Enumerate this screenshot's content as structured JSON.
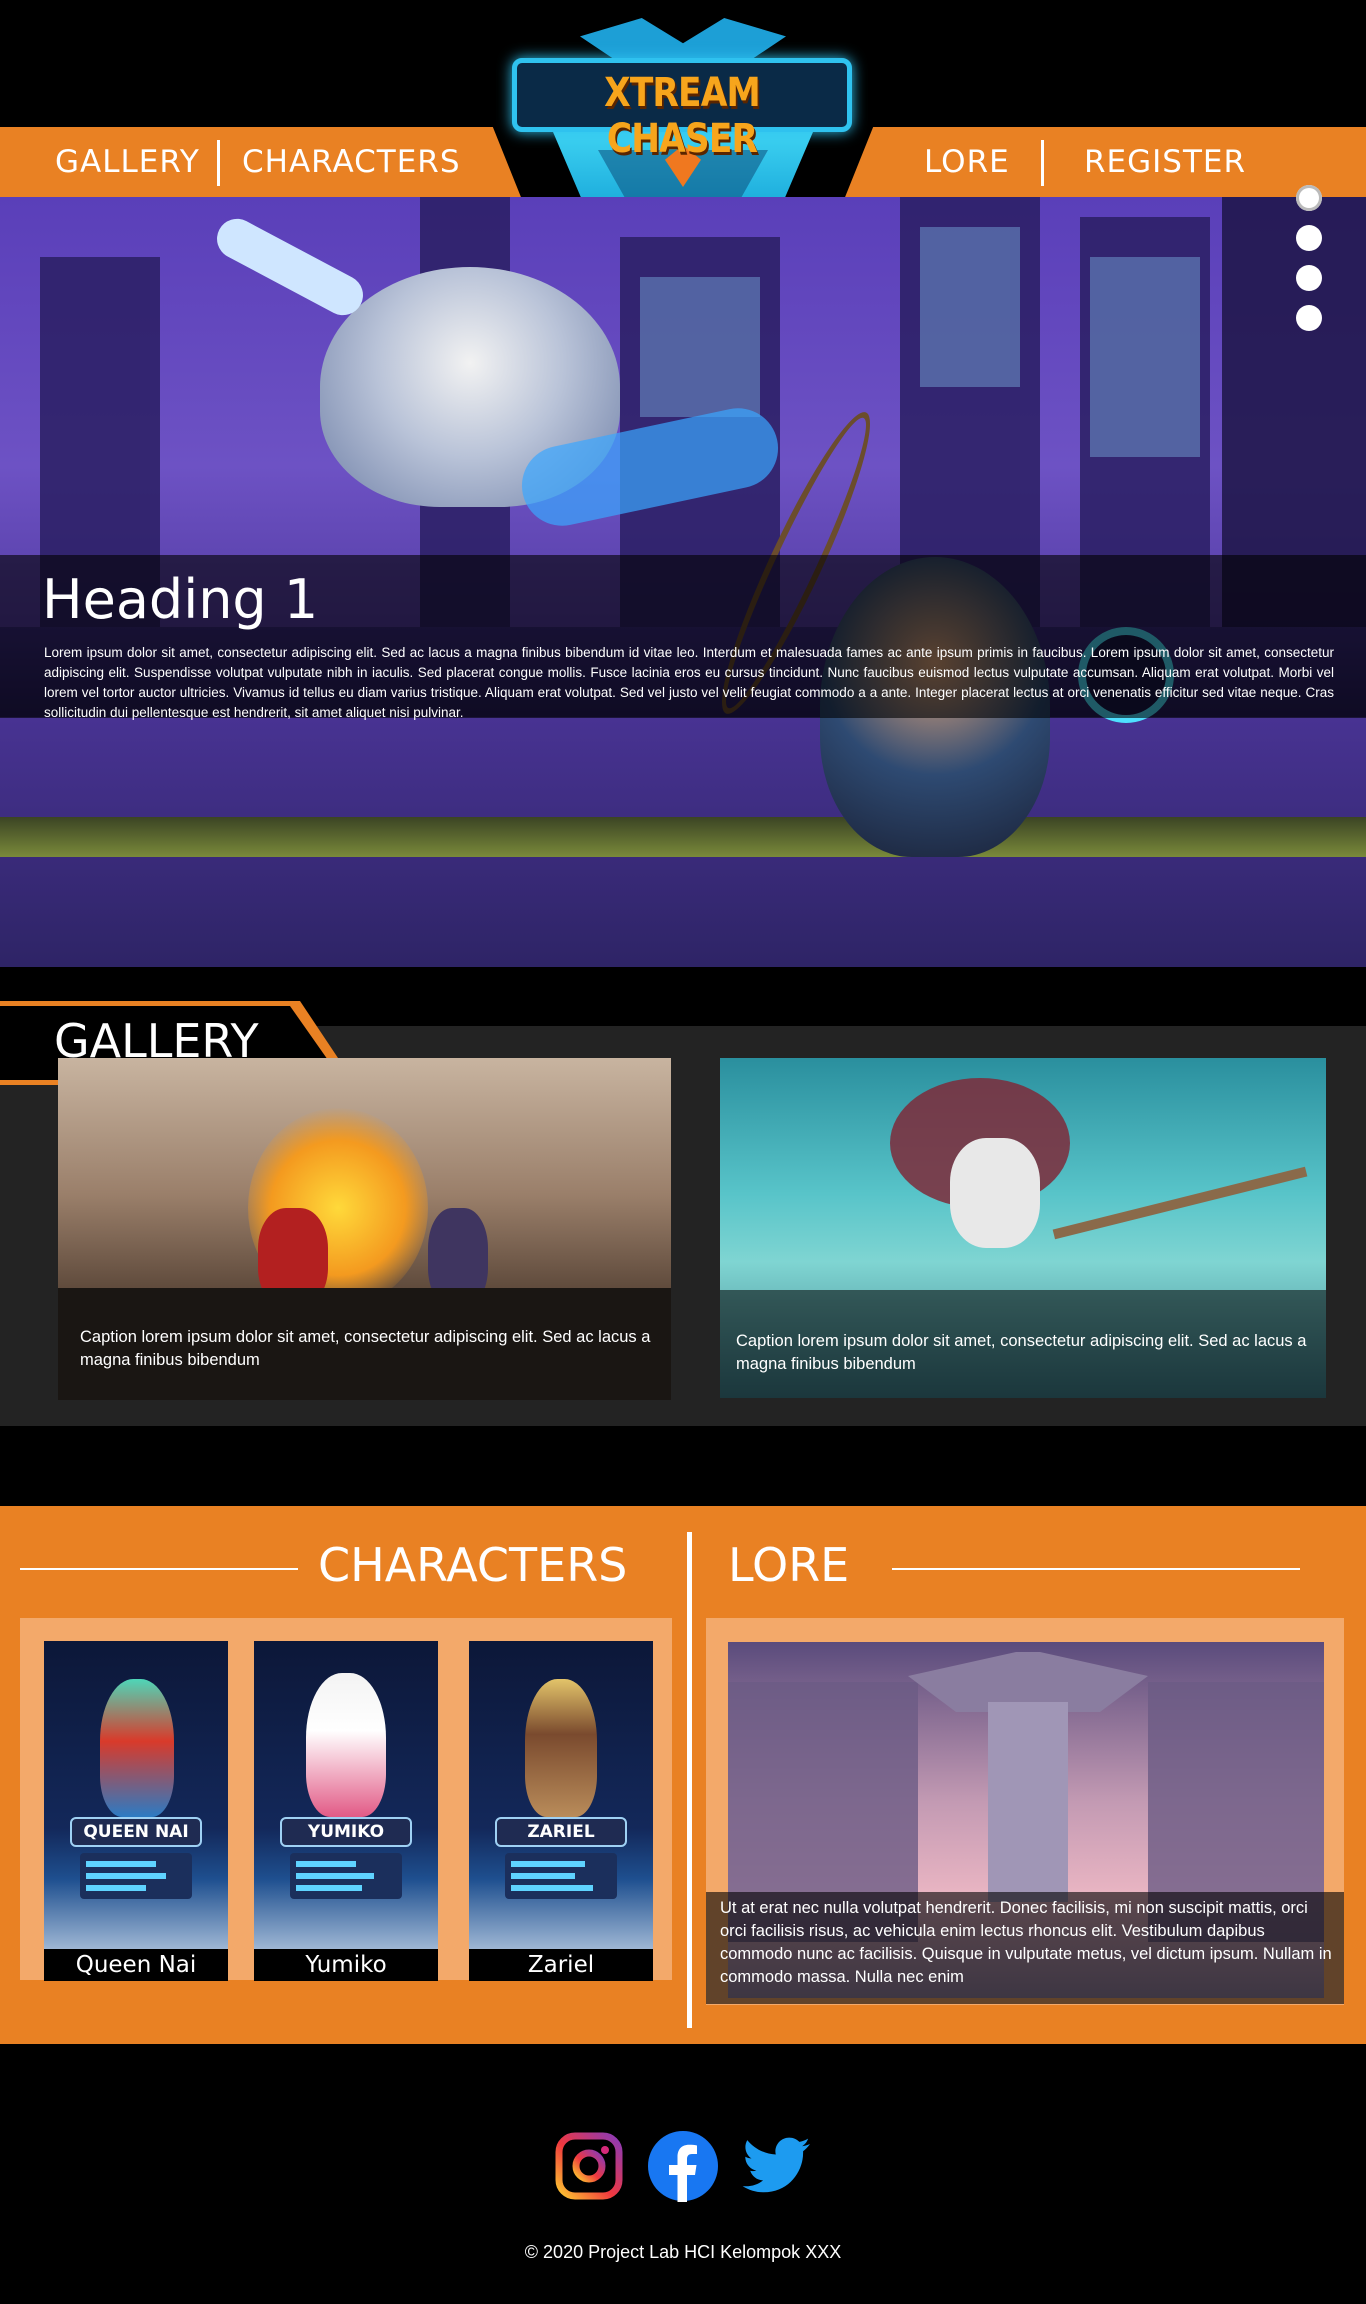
{
  "brand": {
    "logo_text": "XTREAM CHASER"
  },
  "nav": {
    "left": [
      {
        "label": "GALLERY"
      },
      {
        "label": "CHARACTERS"
      }
    ],
    "right": [
      {
        "label": "LORE"
      },
      {
        "label": "REGISTER"
      }
    ]
  },
  "hero": {
    "heading": "Heading 1",
    "text": "Lorem ipsum dolor sit amet, consectetur adipiscing elit. Sed ac lacus a magna finibus bibendum id vitae leo. Interdum et malesuada fames ac ante ipsum primis in faucibus. Lorem ipsum dolor sit amet, consectetur adipiscing elit. Suspendisse volutpat vulputate nibh in iaculis. Sed placerat congue mollis. Fusce lacinia eros eu cursus tincidunt. Nunc faucibus euismod lectus vulputate accumsan. Aliquam erat volutpat. Morbi vel lorem vel tortor auctor ultricies. Vivamus id tellus eu diam varius tristique. Aliquam erat volutpat. Sed vel justo vel velit feugiat commodo a a ante. Integer placerat lectus at orci venenatis efficitur sed vitae neque. Cras sollicitudin dui pellentesque est hendrerit, sit amet aliquet nisi pulvinar.",
    "slides": 4,
    "active_slide": 1
  },
  "gallery": {
    "title": "GALLERY",
    "items": [
      {
        "caption": "Caption lorem ipsum dolor sit amet, consectetur adipiscing elit. Sed ac lacus a magna finibus bibendum"
      },
      {
        "caption": "Caption lorem ipsum dolor sit amet, consectetur adipiscing elit. Sed ac lacus a magna finibus bibendum"
      }
    ]
  },
  "characters": {
    "title": "CHARACTERS",
    "items": [
      {
        "plate": "QUEEN NAI",
        "name": "Queen Nai"
      },
      {
        "plate": "YUMIKO",
        "name": "Yumiko"
      },
      {
        "plate": "ZARIEL",
        "name": "Zariel"
      }
    ]
  },
  "lore": {
    "title": "LORE",
    "text": "Ut at erat nec nulla volutpat hendrerit. Donec facilisis, mi non suscipit mattis, orci orci facilisis risus, ac vehicula enim lectus rhoncus elit. Vestibulum dapibus commodo nunc ac facilisis. Quisque in vulputate metus, vel dictum ipsum. Nullam in commodo massa. Nulla nec enim"
  },
  "social": [
    {
      "icon": "instagram-icon"
    },
    {
      "icon": "facebook-icon"
    },
    {
      "icon": "twitter-icon"
    }
  ],
  "footer": {
    "text": "© 2020 Project Lab HCI Kelompok XXX"
  },
  "colors": {
    "accent": "#e98123",
    "dark": "#232323",
    "background": "#000000",
    "logo_blue": "#2fc2ef"
  }
}
